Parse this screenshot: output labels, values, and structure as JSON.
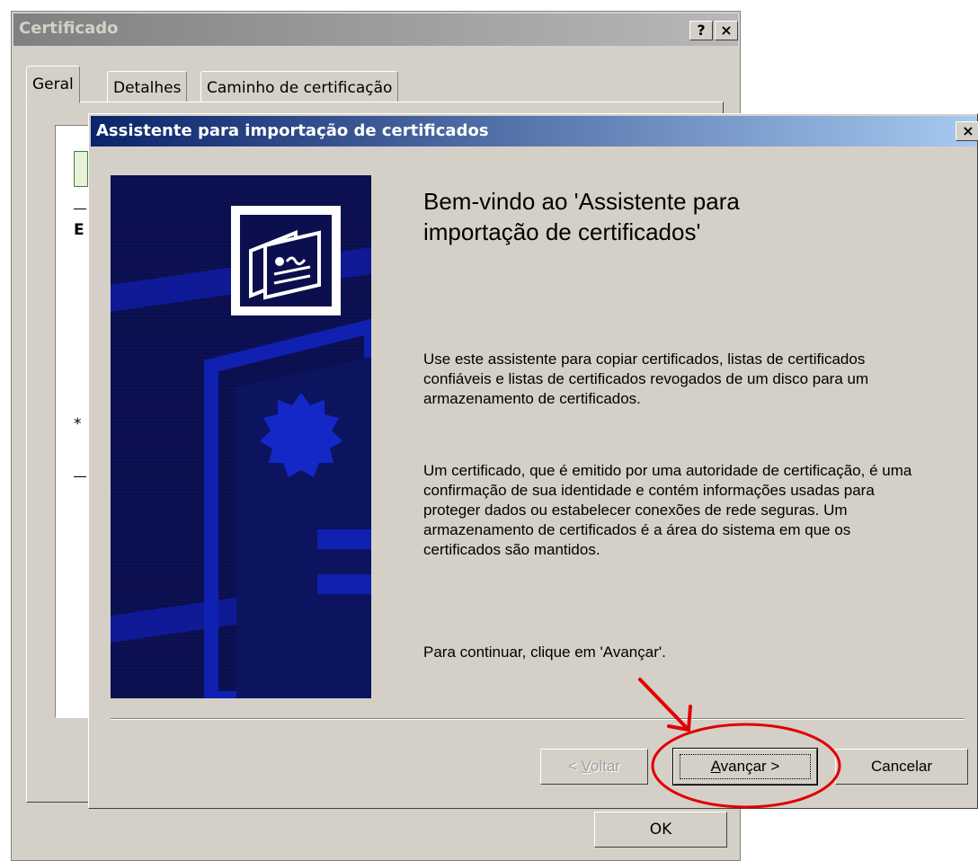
{
  "cert_window": {
    "title": "Certificado",
    "help_button": "?",
    "close_button": "×",
    "tabs": [
      {
        "label": "Geral"
      },
      {
        "label": "Detalhes"
      },
      {
        "label": "Caminho de certificação"
      }
    ],
    "partial_text": {
      "letter": "E",
      "asterisk": "*"
    },
    "ok_label": "OK"
  },
  "wizard": {
    "title": "Assistente para importação de certificados",
    "close_button": "×",
    "heading_line1": "Bem-vindo ao 'Assistente para",
    "heading_line2": "importação de certificados'",
    "paragraph1": "Use este assistente para copiar certificados, listas de certificados confiáveis e listas de certificados revogados de um disco para um armazenamento de certificados.",
    "paragraph2": "Um certificado, que é emitido por uma autoridade de certificação, é uma confirmação de sua identidade e contém informações usadas para proteger dados ou estabelecer conexões de rede seguras. Um armazenamento de certificados é a área do sistema em que os certificados são mantidos.",
    "paragraph3": "Para continuar, clique em 'Avançar'.",
    "buttons": {
      "back_prefix": "< ",
      "back_mnemonic": "V",
      "back_rest": "oltar",
      "next_mnemonic": "A",
      "next_rest": "vançar >",
      "cancel": "Cancelar"
    }
  },
  "icons": {
    "banner_icon": "certificate-icon",
    "annotation": "red-arrow-and-circle-highlight"
  },
  "colors": {
    "dialog_face": "#d4d0c8",
    "wizard_titlebar_start": "#0a246a",
    "wizard_titlebar_end": "#a6caf0",
    "banner_bg": "#0c1150",
    "annotation_red": "#e00000"
  }
}
